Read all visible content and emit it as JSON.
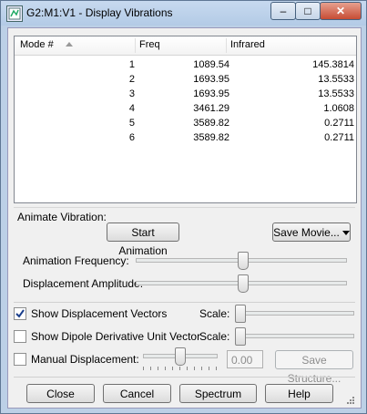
{
  "window": {
    "title": "G2:M1:V1 - Display Vibrations",
    "controls": {
      "minimize": "–",
      "maximize": "□",
      "close": "✕"
    }
  },
  "table": {
    "columns": [
      "Mode #",
      "Freq",
      "Infrared"
    ],
    "rows": [
      [
        "1",
        "1089.54",
        "145.3814"
      ],
      [
        "2",
        "1693.95",
        "13.5533"
      ],
      [
        "3",
        "1693.95",
        "13.5533"
      ],
      [
        "4",
        "3461.29",
        "1.0608"
      ],
      [
        "5",
        "3589.82",
        "0.2711"
      ],
      [
        "6",
        "3589.82",
        "0.2711"
      ]
    ]
  },
  "animate": {
    "group_label": "Animate Vibration:",
    "start_button": "Start Animation",
    "save_movie_button": "Save Movie...",
    "frequency_label": "Animation Frequency:",
    "amplitude_label": "Displacement Amplitude:",
    "frequency_level": 0.51,
    "amplitude_level": 0.51
  },
  "options": {
    "show_displacement": {
      "label": "Show Displacement Vectors",
      "checked": true,
      "scale_label": "Scale:",
      "scale_level": 0.03
    },
    "show_dipole": {
      "label": "Show Dipole Derivative Unit Vector",
      "checked": false,
      "scale_label": "Scale:",
      "scale_level": 0.03
    },
    "manual": {
      "label": "Manual Displacement:",
      "checked": false,
      "value": "0.00",
      "level": 0.5,
      "save_structure_button": "Save Structure..."
    }
  },
  "buttons": {
    "close": "Close",
    "cancel": "Cancel",
    "spectrum": "Spectrum",
    "help": "Help"
  },
  "colors": {
    "titlebar": "#bcd0e6",
    "close_button": "#c74c34",
    "panel": "#f0f0f0"
  }
}
